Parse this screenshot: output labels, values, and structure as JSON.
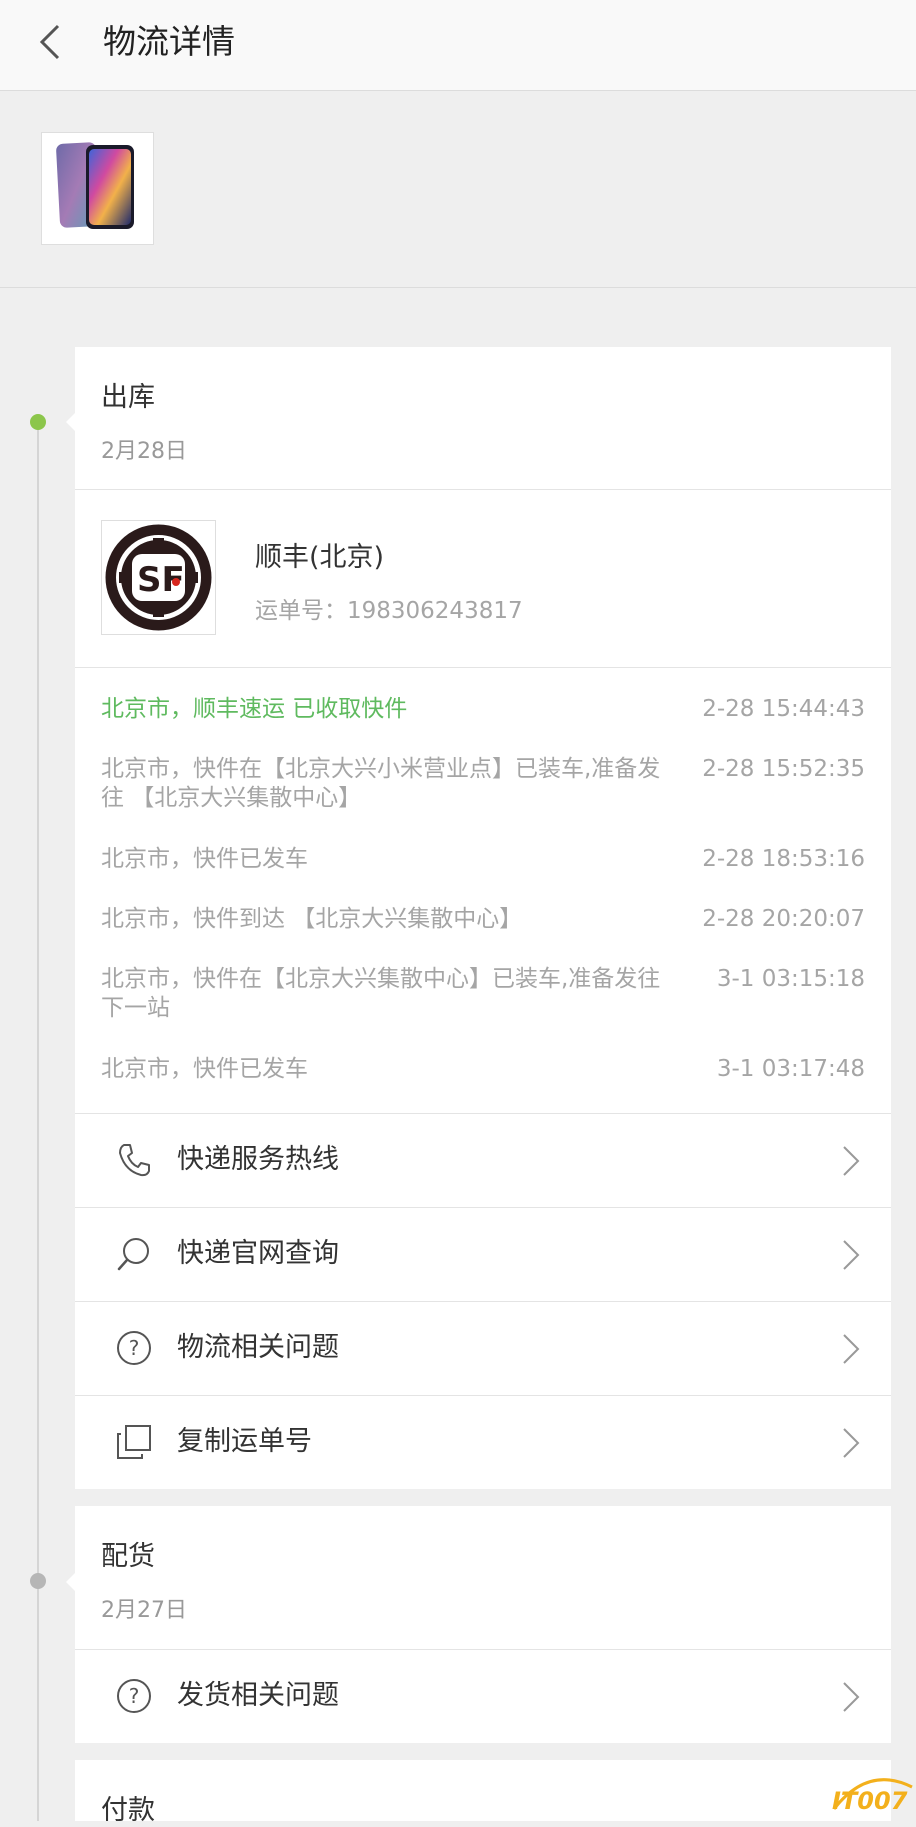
{
  "header": {
    "title": "物流详情"
  },
  "product": {
    "thumbnail": "smartphone-image"
  },
  "stage1": {
    "title": "出库",
    "date": "2月28日",
    "carrier": {
      "name": "顺丰(北京)",
      "waybill": "运单号：198306243817",
      "logo_text": "SF"
    },
    "events": [
      {
        "text": "北京市，顺丰速运 已收取快件",
        "time": "2-28 15:44:43",
        "highlight": true
      },
      {
        "text": "北京市，快件在【北京大兴小米营业点】已装车,准备发往 【北京大兴集散中心】",
        "time": "2-28 15:52:35",
        "highlight": false
      },
      {
        "text": "北京市，快件已发车",
        "time": "2-28 18:53:16",
        "highlight": false
      },
      {
        "text": "北京市，快件到达 【北京大兴集散中心】",
        "time": "2-28 20:20:07",
        "highlight": false
      },
      {
        "text": "北京市，快件在【北京大兴集散中心】已装车,准备发往下一站",
        "time": "3-1 03:15:18",
        "highlight": false
      },
      {
        "text": "北京市，快件已发车",
        "time": "3-1 03:17:48",
        "highlight": false
      }
    ],
    "menu": [
      {
        "label": "快递服务热线",
        "icon": "phone-icon"
      },
      {
        "label": "快递官网查询",
        "icon": "search-icon"
      },
      {
        "label": "物流相关问题",
        "icon": "question-icon"
      },
      {
        "label": "复制运单号",
        "icon": "copy-icon"
      }
    ]
  },
  "stage2": {
    "title": "配货",
    "date": "2月27日",
    "menu": [
      {
        "label": "发货相关问题",
        "icon": "question-icon"
      }
    ]
  },
  "stage3": {
    "title": "付款"
  },
  "watermark": {
    "text": "IT007"
  },
  "colors": {
    "accent_green": "#5fba5f",
    "dot_green": "#8cc64b",
    "muted": "#a5a5a5",
    "background": "#efefef"
  }
}
